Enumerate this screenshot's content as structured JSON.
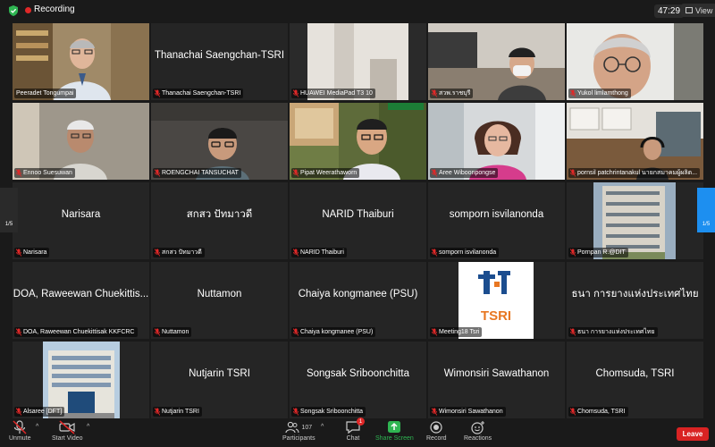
{
  "topbar": {
    "recording_label": "Recording",
    "timer": "47:29",
    "view_label": "View",
    "colors": {
      "recording": "#e02828",
      "secure": "#2fb552"
    }
  },
  "tiles": [
    {
      "display": "video",
      "scene": "office-bookshelf",
      "label": "Peeradet Tongumpai",
      "muted": false,
      "active": true
    },
    {
      "display": "name",
      "name": "Thanachai Saengchan-TSRI",
      "label": "Thanachai Saengchan-TSRI",
      "muted": true
    },
    {
      "display": "video",
      "scene": "ceiling-tablet",
      "label": "HUAWEI MediaPad T3 10",
      "muted": true
    },
    {
      "display": "video",
      "scene": "office-mask",
      "label": "สวพ.ราชบุรี",
      "muted": true
    },
    {
      "display": "video",
      "scene": "glasses-man",
      "label": "Yukol limlamthong",
      "muted": true
    },
    {
      "display": "video",
      "scene": "elder-man",
      "label": "Ennoo Suesuwan",
      "muted": true
    },
    {
      "display": "video",
      "scene": "dim-room",
      "label": "ROENGCHAI TANSUCHAT",
      "muted": true
    },
    {
      "display": "video",
      "scene": "virtual-bg-man",
      "label": "Pipat Weerathaworn",
      "muted": true
    },
    {
      "display": "video",
      "scene": "woman-pink",
      "label": "Aree Wiboonpongse",
      "muted": true
    },
    {
      "display": "video",
      "scene": "room-headphones",
      "label": "pornsil patchrintanakul นายกสมาคมผู้ผลิต...",
      "muted": true
    },
    {
      "display": "name",
      "name": "Narisara",
      "label": "Narisara",
      "muted": true
    },
    {
      "display": "name",
      "name": "สกสว ปัทมาวดี",
      "label": "สกสว ปัทมาวดี",
      "muted": true
    },
    {
      "display": "name",
      "name": "NARID Thaiburi",
      "label": "NARID Thaiburi",
      "muted": true
    },
    {
      "display": "name",
      "name": "somporn isvilanonda",
      "label": "somporn isvilanonda",
      "muted": true
    },
    {
      "display": "video",
      "scene": "building",
      "label": "Pornpan R.@DIT",
      "muted": true
    },
    {
      "display": "name",
      "name": "DOA, Raweewan Chuekittis...",
      "label": "DOA, Raweewan Chuekittisak KKFCRC",
      "muted": true
    },
    {
      "display": "name",
      "name": "Nuttamon",
      "label": "Nuttamon",
      "muted": true
    },
    {
      "display": "name",
      "name": "Chaiya kongmanee (PSU)",
      "label": "Chaiya kongmanee (PSU)",
      "muted": true
    },
    {
      "display": "logo",
      "logo_text": "TSRI",
      "label": "Meeting18 Tsri",
      "muted": true
    },
    {
      "display": "name",
      "name": "ธนา การยางแห่งประเทศไทย",
      "label": "ธนา การยางแห่งประเทศไทย",
      "muted": true
    },
    {
      "display": "video",
      "scene": "gov-building",
      "label": "Alsaree [DFT]",
      "muted": true
    },
    {
      "display": "name",
      "name": "Nutjarin TSRI",
      "label": "Nutjarin TSRI",
      "muted": true
    },
    {
      "display": "name",
      "name": "Songsak Sriboonchitta",
      "label": "Songsak Sriboonchitta",
      "muted": true
    },
    {
      "display": "name",
      "name": "Wimonsiri Sawathanon",
      "label": "Wimonsiri Sawathanon",
      "muted": true
    },
    {
      "display": "name",
      "name": "Chomsuda, TSRI",
      "label": "Chomsuda, TSRI",
      "muted": true
    }
  ],
  "nav": {
    "left_page": "1/5",
    "right_page": "1/5"
  },
  "toolbar": {
    "unmute": "Unmute",
    "start_video": "Start Video",
    "participants": "Participants",
    "participants_count": "107",
    "chat": "Chat",
    "chat_badge": "1",
    "share_screen": "Share Screen",
    "record": "Record",
    "reactions": "Reactions",
    "leave": "Leave"
  },
  "icons": {
    "secure": "shield-check-icon",
    "recording": "recording-dot-icon",
    "mic": "mic-muted-icon",
    "video": "video-off-icon",
    "participants": "people-icon",
    "chat": "chat-bubble-icon",
    "share": "share-arrow-icon",
    "record": "record-icon",
    "reactions": "smiley-plus-icon"
  }
}
